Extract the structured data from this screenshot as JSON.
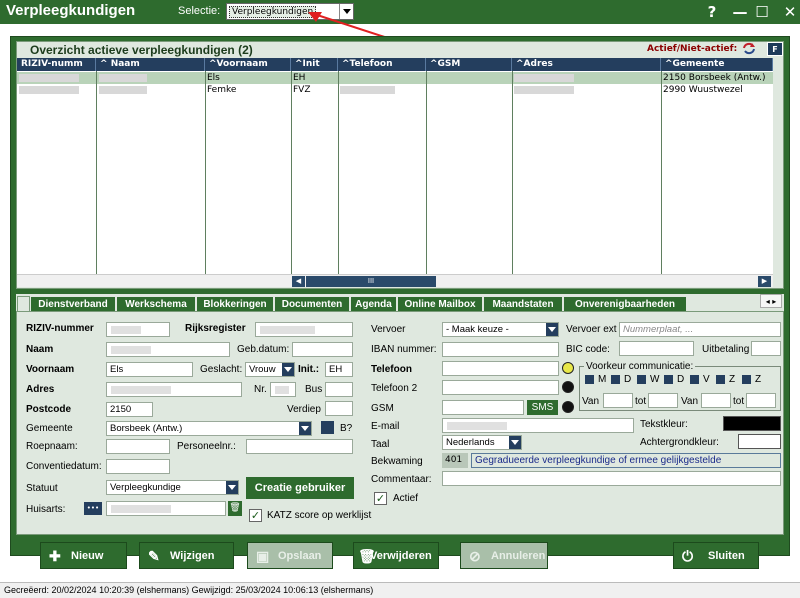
{
  "window": {
    "title": "Verpleegkundigen",
    "selectie_label": "Selectie:",
    "selectie_value": "Verpleegkundigen",
    "help": "?",
    "min": "—",
    "max": "☐",
    "close": "✕"
  },
  "grid": {
    "title": "Overzicht actieve verpleegkundigen (2)",
    "actief_label": "Actief/Niet-actief:",
    "f_button": "F",
    "columns": [
      "RIZIV-numm",
      "Naam",
      "Voornaam",
      "Init",
      "Telefoon",
      "GSM",
      "Adres",
      "Gemeente"
    ],
    "rows": [
      {
        "voornaam": "Els",
        "init": "EH",
        "gemeente": "2150 Borsbeek (Antw.)"
      },
      {
        "voornaam": "Femke",
        "init": "FVZ",
        "gemeente": "2990 Wuustwezel"
      }
    ],
    "scroll_thumb": "III"
  },
  "tabs": [
    "Dienstverband",
    "Werkschema",
    "Blokkeringen",
    "Documenten",
    "Agenda",
    "Online Mailbox",
    "Maandstaten",
    "Onverenigbaarheden"
  ],
  "form": {
    "riziv_label": "RIZIV-nummer",
    "rijksregister_label": "Rijksregister",
    "naam_label": "Naam",
    "gebdatum_label": "Geb.datum:",
    "voornaam_label": "Voornaam",
    "voornaam_value": "Els",
    "geslacht_label": "Geslacht:",
    "geslacht_value": "Vrouw",
    "init_label": "Init.:",
    "init_value": "EH",
    "adres_label": "Adres",
    "nr_label": "Nr.",
    "bus_label": "Bus",
    "postcode_label": "Postcode",
    "postcode_value": "2150",
    "verdiep_label": "Verdiep",
    "gemeente_label": "Gemeente",
    "gemeente_value": "Borsbeek (Antw.)",
    "b_label": "B?",
    "roepnaam_label": "Roepnaam:",
    "personeelnr_label": "Personeelnr.:",
    "conventiedatum_label": "Conventiedatum:",
    "statuut_label": "Statuut",
    "statuut_value": "Verpleegkundige",
    "creatie_button": "Creatie gebruiker",
    "huisarts_label": "Huisarts:",
    "huisarts_dots": "•••",
    "katz_label": "KATZ score op werklijst",
    "vervoer_label": "Vervoer",
    "vervoer_value": "- Maak keuze -",
    "vervoer_ext_label": "Vervoer ext",
    "vervoer_ext_placeholder": "Nummerplaat, ...",
    "iban_label": "IBAN nummer:",
    "bic_label": "BIC code:",
    "uitbetaling_label": "Uitbetaling",
    "telefoon_label": "Telefoon",
    "telefoon2_label": "Telefoon 2",
    "gsm_label": "GSM",
    "sms_button": "SMS",
    "voorkeur_title": "Voorkeur communicatie:",
    "days": [
      "M",
      "D",
      "W",
      "D",
      "V",
      "Z",
      "Z"
    ],
    "van_label": "Van",
    "tot_label": "tot",
    "email_label": "E-mail",
    "tekstkleur_label": "Tekstkleur:",
    "achtergrondkleur_label": "Achtergrondkleur:",
    "taal_label": "Taal",
    "taal_value": "Nederlands",
    "bekwaming_label": "Bekwaming",
    "bekwaming_code": "401",
    "bekwaming_value": "Gegradueerde verpleegkundige of ermee gelijkgestelde",
    "commentaar_label": "Commentaar:",
    "actief_label": "Actief"
  },
  "buttons": {
    "nieuw": "Nieuw",
    "wijzigen": "Wijzigen",
    "opslaan": "Opslaan",
    "verwijderen": "Verwijderen",
    "annuleren": "Annuleren",
    "sluiten": "Sluiten"
  },
  "status": {
    "text": "Gecreëerd: 20/02/2024 10:20:39 (elshermans) Gewijzigd: 25/03/2024 10:06:13 (elshermans)"
  },
  "colors": {
    "green": "#2e6b2e",
    "navy": "#243e5e",
    "panel": "#dfe8df"
  }
}
